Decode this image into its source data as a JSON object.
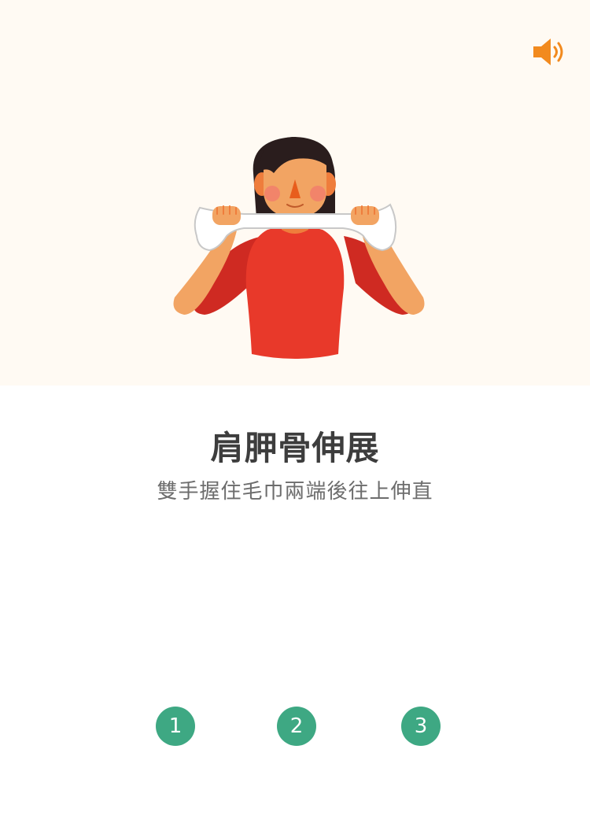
{
  "exercise": {
    "title": "肩胛骨伸展",
    "instruction": "雙手握住毛巾兩端後往上伸直"
  },
  "audio": {
    "icon": "speaker-icon",
    "color": "#f28a1e"
  },
  "steps": [
    {
      "label": "1"
    },
    {
      "label": "2"
    },
    {
      "label": "3"
    }
  ],
  "colors": {
    "hero_bg": "#fffaf3",
    "step_bg": "#3ea883",
    "title": "#3d3d3d",
    "subtitle": "#6d6d6d"
  }
}
